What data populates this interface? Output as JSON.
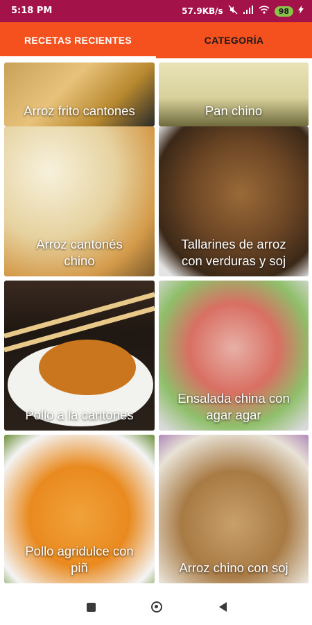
{
  "status_bar": {
    "time": "5:18 PM",
    "network_speed": "57.9KB/s",
    "battery": "98",
    "icons": [
      "mute-icon",
      "signal-icon",
      "wifi-icon",
      "battery-icon"
    ]
  },
  "tabs": [
    {
      "label": "RECETAS RECIENTES",
      "active": true
    },
    {
      "label": "CATEGORÍA",
      "active": false
    }
  ],
  "recipes": [
    {
      "title": "Arroz frito cantones"
    },
    {
      "title": "Pan chino"
    },
    {
      "title": "Arroz cantonés\nchino"
    },
    {
      "title": "Tallarines de arroz\ncon verduras y soj"
    },
    {
      "title": "Pollo a la cantones"
    },
    {
      "title": "Ensalada china con\nagar agar"
    },
    {
      "title": "Pollo agridulce con\npiñ"
    },
    {
      "title": "Arroz chino con soj"
    }
  ],
  "colors": {
    "status_bar": "#a31249",
    "tab_bar": "#f4511e",
    "battery": "#8bc34a"
  },
  "nav_bar": {
    "icons": [
      "recents-square-icon",
      "home-circle-icon",
      "back-triangle-icon"
    ]
  }
}
